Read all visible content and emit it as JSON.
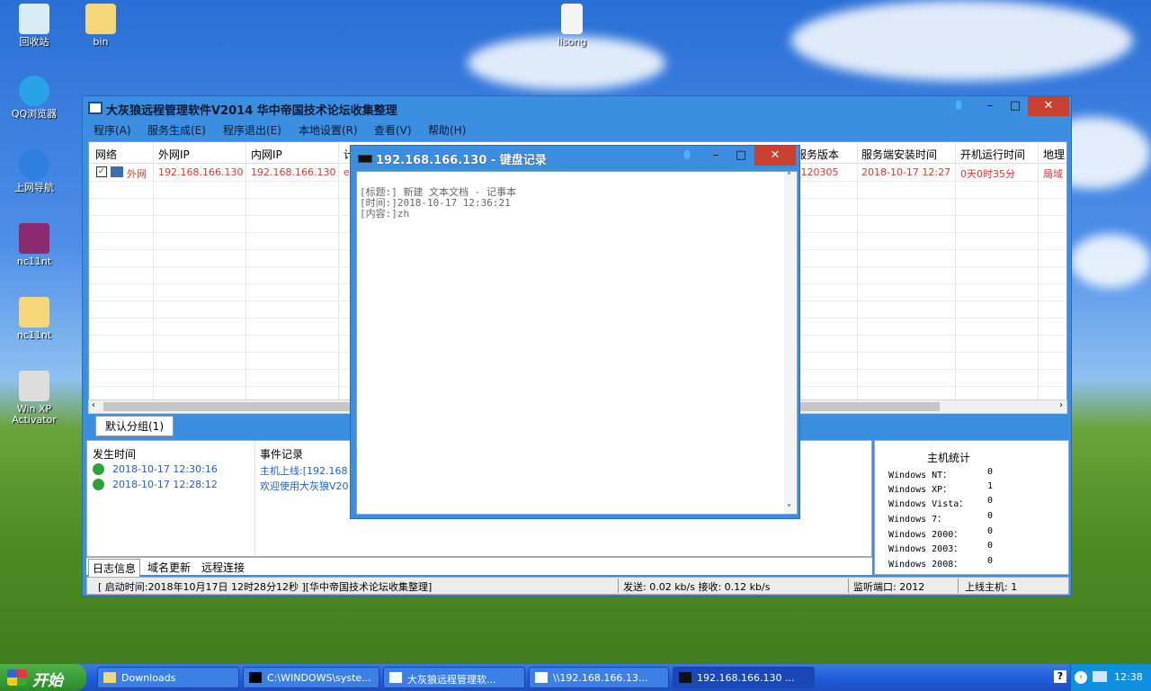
{
  "desktop": {
    "icons": [
      {
        "label": "回收站"
      },
      {
        "label": "bin"
      },
      {
        "label": "lisong"
      },
      {
        "label": "QQ浏览器"
      },
      {
        "label": "上网导航"
      },
      {
        "label": "nc11nt"
      },
      {
        "label": "nc11nt"
      },
      {
        "label": "Win XP Activator"
      }
    ]
  },
  "main": {
    "title": "大灰狼远程管理软件V2014   华中帝国技术论坛收集整理",
    "menu": [
      "程序(A)",
      "服务生成(E)",
      "程序退出(E)",
      "本地设置(R)",
      "查看(V)",
      "帮助(H)"
    ],
    "columns": [
      "网络",
      "外网IP",
      "内网IP",
      "计",
      "服务版本",
      "服务端安装时间",
      "开机运行时间",
      "地理"
    ],
    "row": {
      "network": "外网",
      "wan_ip": "192.168.166.130",
      "lan_ip": "192.168.166.130",
      "computer": "e",
      "version": "_120305",
      "install_time": "2018-10-17 12:27",
      "uptime": "0天0时35分",
      "location": "局域"
    },
    "group_tab": "默认分组(1)",
    "log": {
      "headers": [
        "发生时间",
        "事件记录"
      ],
      "rows": [
        {
          "time": "2018-10-17 12:30:16",
          "event": "主机上线:[192.168"
        },
        {
          "time": "2018-10-17 12:28:12",
          "event": "欢迎使用大灰狼V20"
        }
      ]
    },
    "stats": {
      "title": "主机统计",
      "items": [
        {
          "label": "Windows NT：",
          "value": "0"
        },
        {
          "label": "Windows XP：",
          "value": "1"
        },
        {
          "label": "Windows Vista：",
          "value": "0"
        },
        {
          "label": "Windows 7：",
          "value": "0"
        },
        {
          "label": "Windows 2000：",
          "value": "0"
        },
        {
          "label": "Windows 2003：",
          "value": "0"
        },
        {
          "label": "Windows 2008：",
          "value": "0"
        }
      ]
    },
    "bottom_tabs": [
      "日志信息",
      "域名更新",
      "远程连接"
    ],
    "status": {
      "start": "[ 启动时间:2018年10月17日 12时28分12秒 ][华中帝国技术论坛收集整理]",
      "speed": "发送: 0.02 kb/s 接收: 0.12 kb/s",
      "port": "监听端口: 2012",
      "online": "上线主机: 1"
    }
  },
  "dialog": {
    "title": "192.168.166.130 - 键盘记录",
    "lines": [
      "[标题:] 新建 文本文档 - 记事本",
      "[时间:]2018-10-17  12:36:21",
      "[内容:]zh"
    ]
  },
  "taskbar": {
    "start": "开始",
    "tasks": [
      "Downloads",
      "C:\\WINDOWS\\syste...",
      "大灰狼远程管理软...",
      "\\\\192.168.166.13...",
      "192.168.166.130 ..."
    ],
    "clock": "12:38"
  }
}
